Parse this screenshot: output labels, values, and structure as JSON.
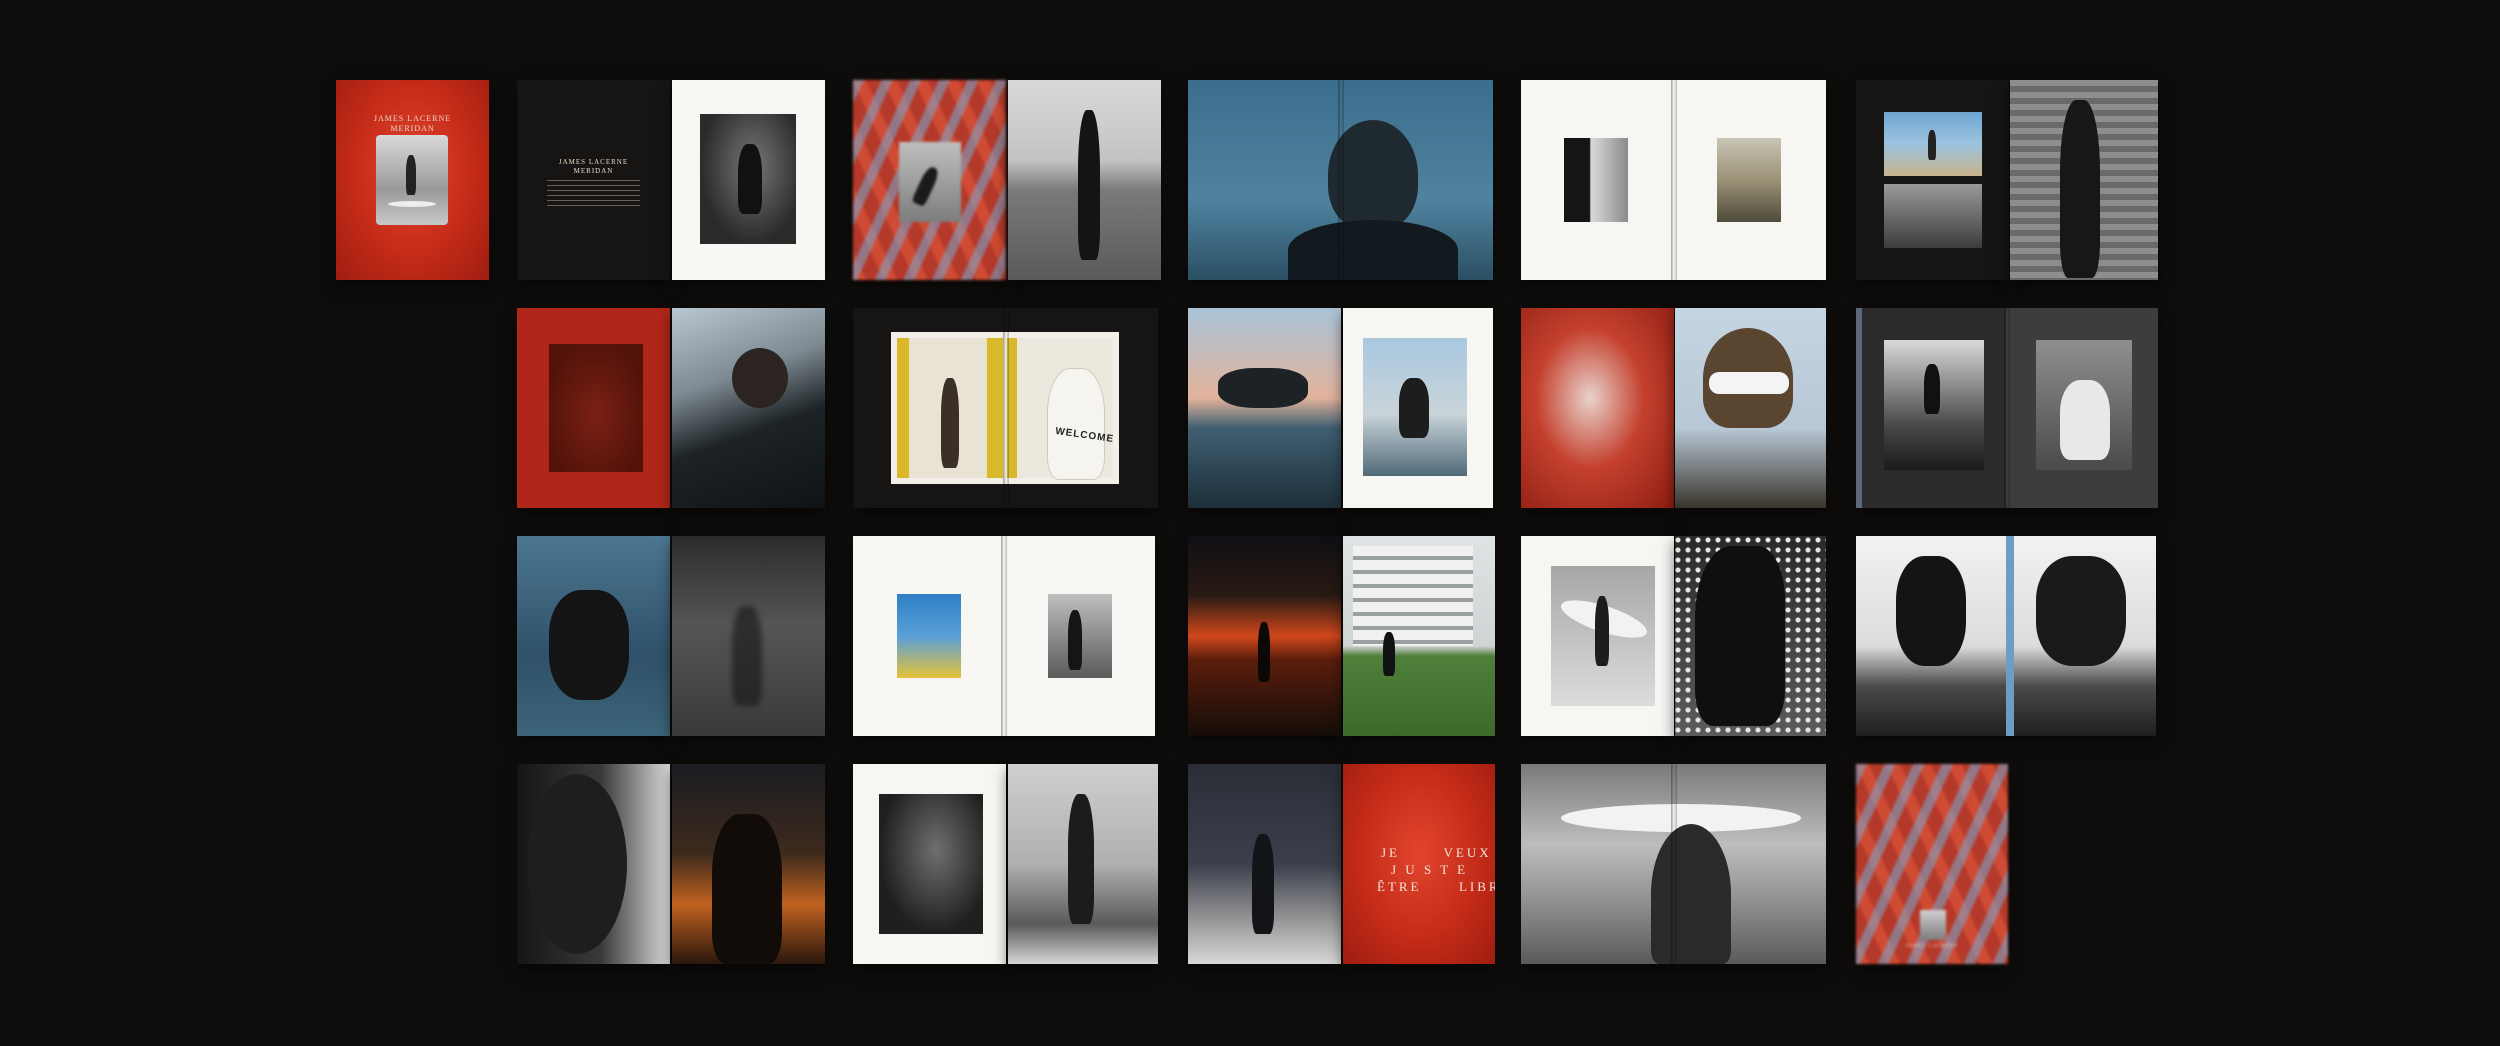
{
  "magazine": {
    "cover_title_line1": "JAMES LACERNE",
    "cover_title_line2": "MERIDAN",
    "intro_title_line1": "JAMES LACERNE",
    "intro_title_line2": "MERIDAN",
    "welcome_sign": "WELCOME",
    "quote_line1": "JE       VEUX",
    "quote_line2": "J U S T E",
    "quote_line3": "ÊTRE      LIBRE",
    "back_title": "JAMES LACERNE"
  },
  "colors": {
    "background": "#0f0d0b",
    "accent_red": "#c42b18",
    "paper": "#f7f6f3"
  }
}
